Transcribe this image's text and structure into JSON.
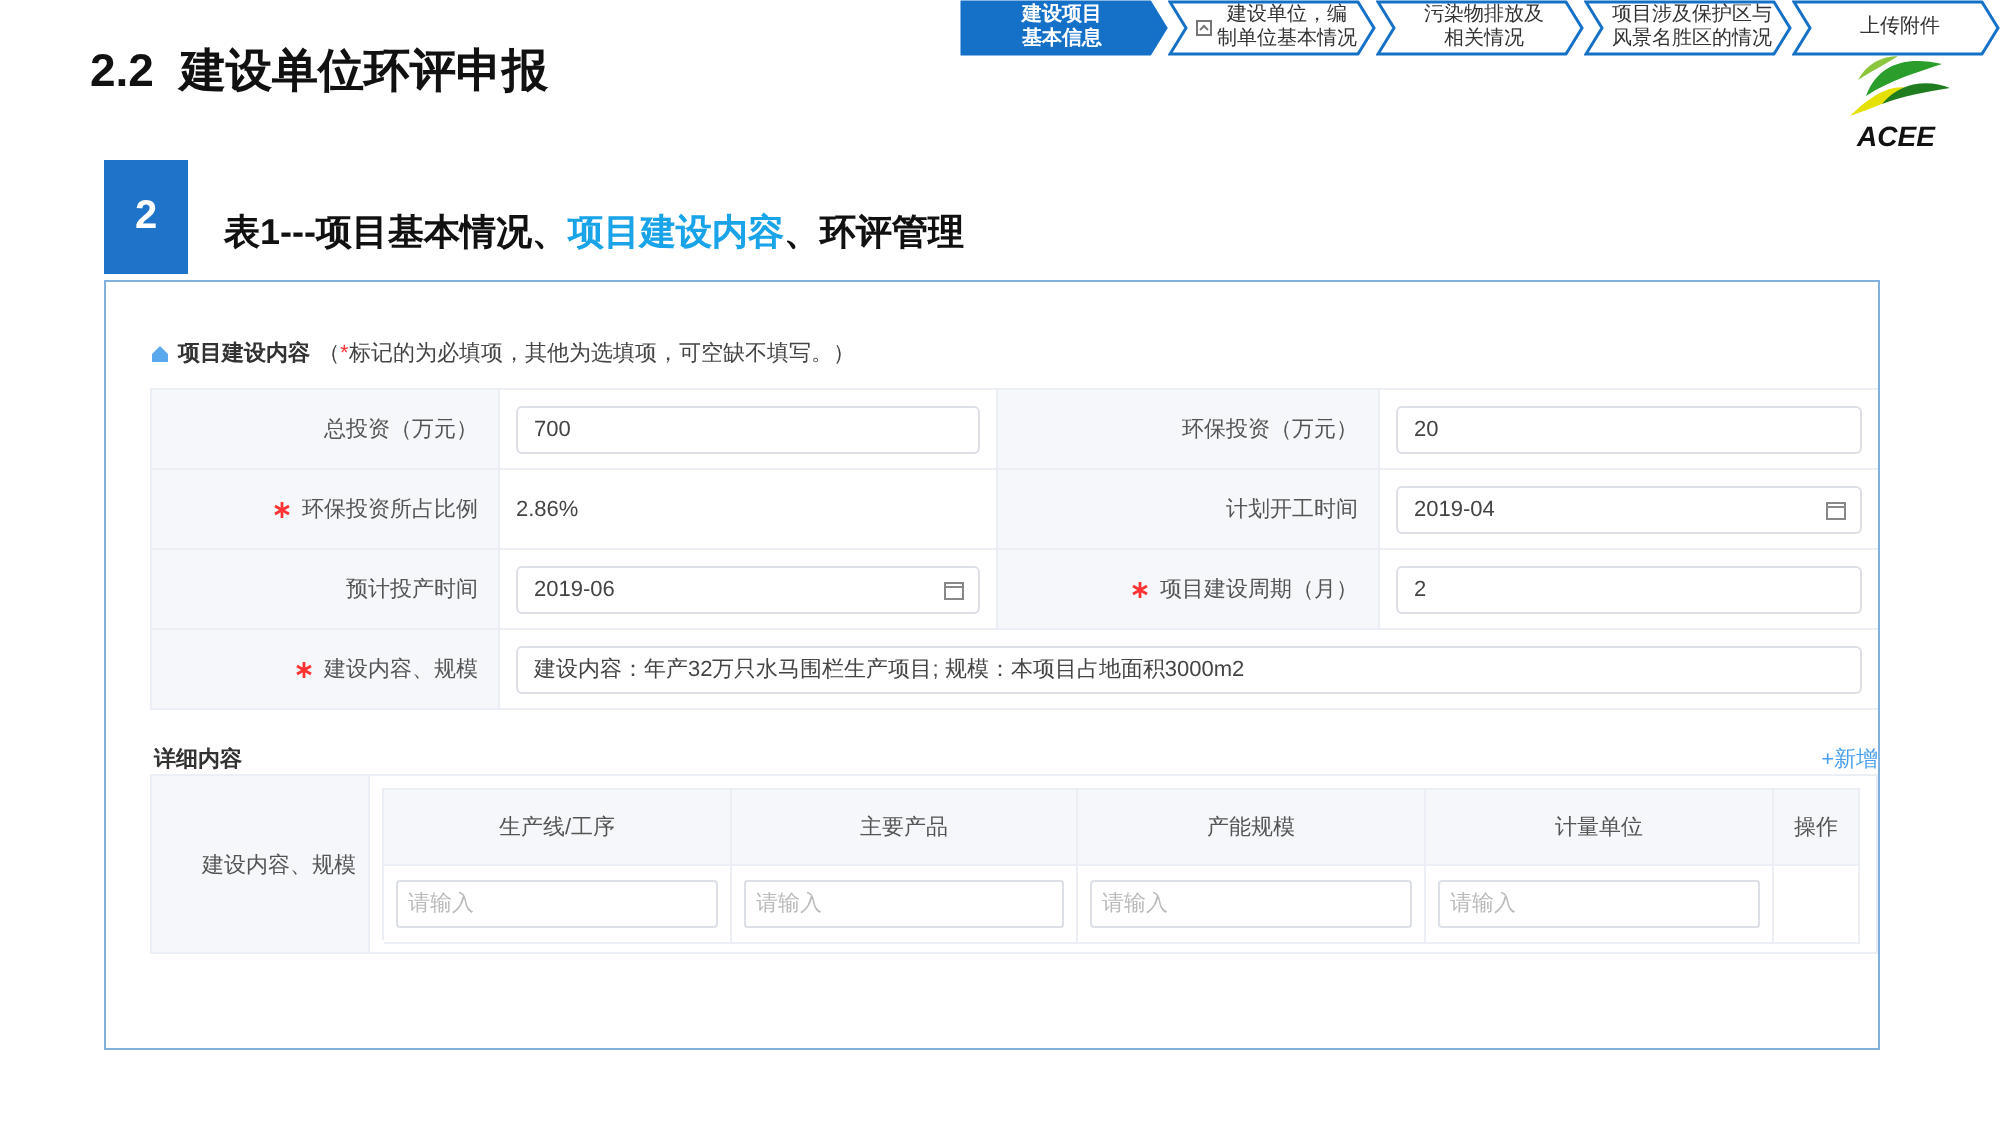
{
  "page_title": "2.2  建设单位环评申报",
  "steps": [
    {
      "lines": [
        "建设项目",
        "基本信息"
      ],
      "selected": true,
      "has_icon": false
    },
    {
      "lines": [
        "建设单位，编",
        "制单位基本情况"
      ],
      "selected": false,
      "has_icon": true
    },
    {
      "lines": [
        "污染物排放及",
        "相关情况"
      ],
      "selected": false,
      "has_icon": false
    },
    {
      "lines": [
        "项目涉及保护区与",
        "风景名胜区的情况"
      ],
      "selected": false,
      "has_icon": false
    },
    {
      "lines": [
        "上传附件"
      ],
      "selected": false,
      "has_icon": false
    }
  ],
  "logo": {
    "text": "ACEE"
  },
  "section_number": "2",
  "heading": [
    {
      "text": "表1---项目基本情况、",
      "highlight": false
    },
    {
      "text": "项目建设内容",
      "highlight": true
    },
    {
      "text": "、环评管理",
      "highlight": false
    }
  ],
  "form": {
    "title": "项目建设内容",
    "note_open": "（",
    "note_star": "*",
    "note": "标记的为必填项，其他为选填项，可空缺不填写。）",
    "fields": [
      {
        "label": "总投资（万元）",
        "required": false,
        "kind": "input",
        "value": "700",
        "wide": false
      },
      {
        "label": "环保投资（万元）",
        "required": false,
        "kind": "input",
        "value": "20",
        "wide": false
      },
      {
        "label": "环保投资所占比例",
        "required": true,
        "kind": "text",
        "value": "2.86%",
        "wide": false
      },
      {
        "label": "计划开工时间",
        "required": false,
        "kind": "date",
        "value": "2019-04",
        "wide": false
      },
      {
        "label": "预计投产时间",
        "required": false,
        "kind": "date",
        "value": "2019-06",
        "wide": false
      },
      {
        "label": "项目建设周期（月）",
        "required": true,
        "kind": "input",
        "value": "2",
        "wide": false
      },
      {
        "label": "建设内容、规模",
        "required": true,
        "kind": "input",
        "value": "建设内容：年产32万只水马围栏生产项目; 规模：本项目占地面积3000m2",
        "wide": true
      }
    ]
  },
  "details": {
    "title": "详细内容",
    "add_link": "+新增",
    "row_label": "建设内容、规模",
    "columns": [
      "生产线/工序",
      "主要产品",
      "产能规模",
      "计量单位",
      "操作"
    ],
    "placeholders": [
      "请输入",
      "请输入",
      "请输入",
      "请输入"
    ]
  }
}
